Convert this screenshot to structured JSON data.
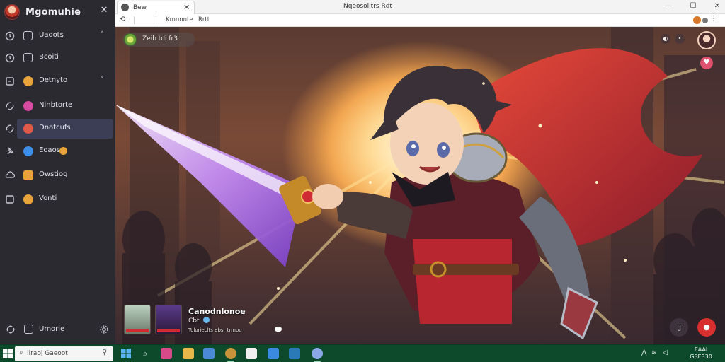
{
  "sidebar": {
    "title": "Mgomuhie",
    "items": [
      {
        "label": "Uaoots",
        "icon": "clock-icon",
        "marker": "box",
        "chevron": "˄"
      },
      {
        "label": "Bcoiti",
        "icon": "clock-icon",
        "marker": "box",
        "chevron": ""
      },
      {
        "label": "Detnyto",
        "icon": "box-icon",
        "marker": "dot",
        "color": "#e8a33a",
        "chevron": "˅"
      },
      {
        "label": "Ninbtorte",
        "icon": "link-icon",
        "marker": "dot",
        "color": "#d64aa0",
        "chevron": ""
      },
      {
        "label": "Dnotcufs",
        "icon": "link-icon",
        "marker": "dot",
        "color": "#e05a4a",
        "chevron": "",
        "active": true
      },
      {
        "label": "Eoaos",
        "icon": "pin-icon",
        "marker": "dot",
        "color": "#3d8ee8",
        "chevron": "",
        "coin": true
      },
      {
        "label": "Owstiog",
        "icon": "cloud-icon",
        "marker": "dot",
        "color": "#e8a33a",
        "chevron": ""
      },
      {
        "label": "Vonti",
        "icon": "box-icon",
        "marker": "dot",
        "color": "#e8a33a",
        "chevron": ""
      }
    ],
    "footer": {
      "label": "Umorie"
    }
  },
  "window": {
    "tab_label": "Bew",
    "title": "Nqeosoiitrs Rdt",
    "toolbar": {
      "item1": "Kmnnnte",
      "item2": "Rrtt"
    }
  },
  "stage": {
    "channel_label": "Zeib tdi fr3",
    "stream_title": "Canodnlonoe",
    "stream_sub": "Cbt",
    "stream_meta": "Tolorieclts ebsr trmou"
  },
  "taskbar": {
    "search_placeholder": "Ilraoj Gaeoot",
    "clock_time": "EAAI",
    "clock_date": "GSES30"
  },
  "colors": {
    "accent_active": "#3b3e55",
    "taskbar": "#0c4a2b",
    "live_red": "#d82f2f"
  }
}
